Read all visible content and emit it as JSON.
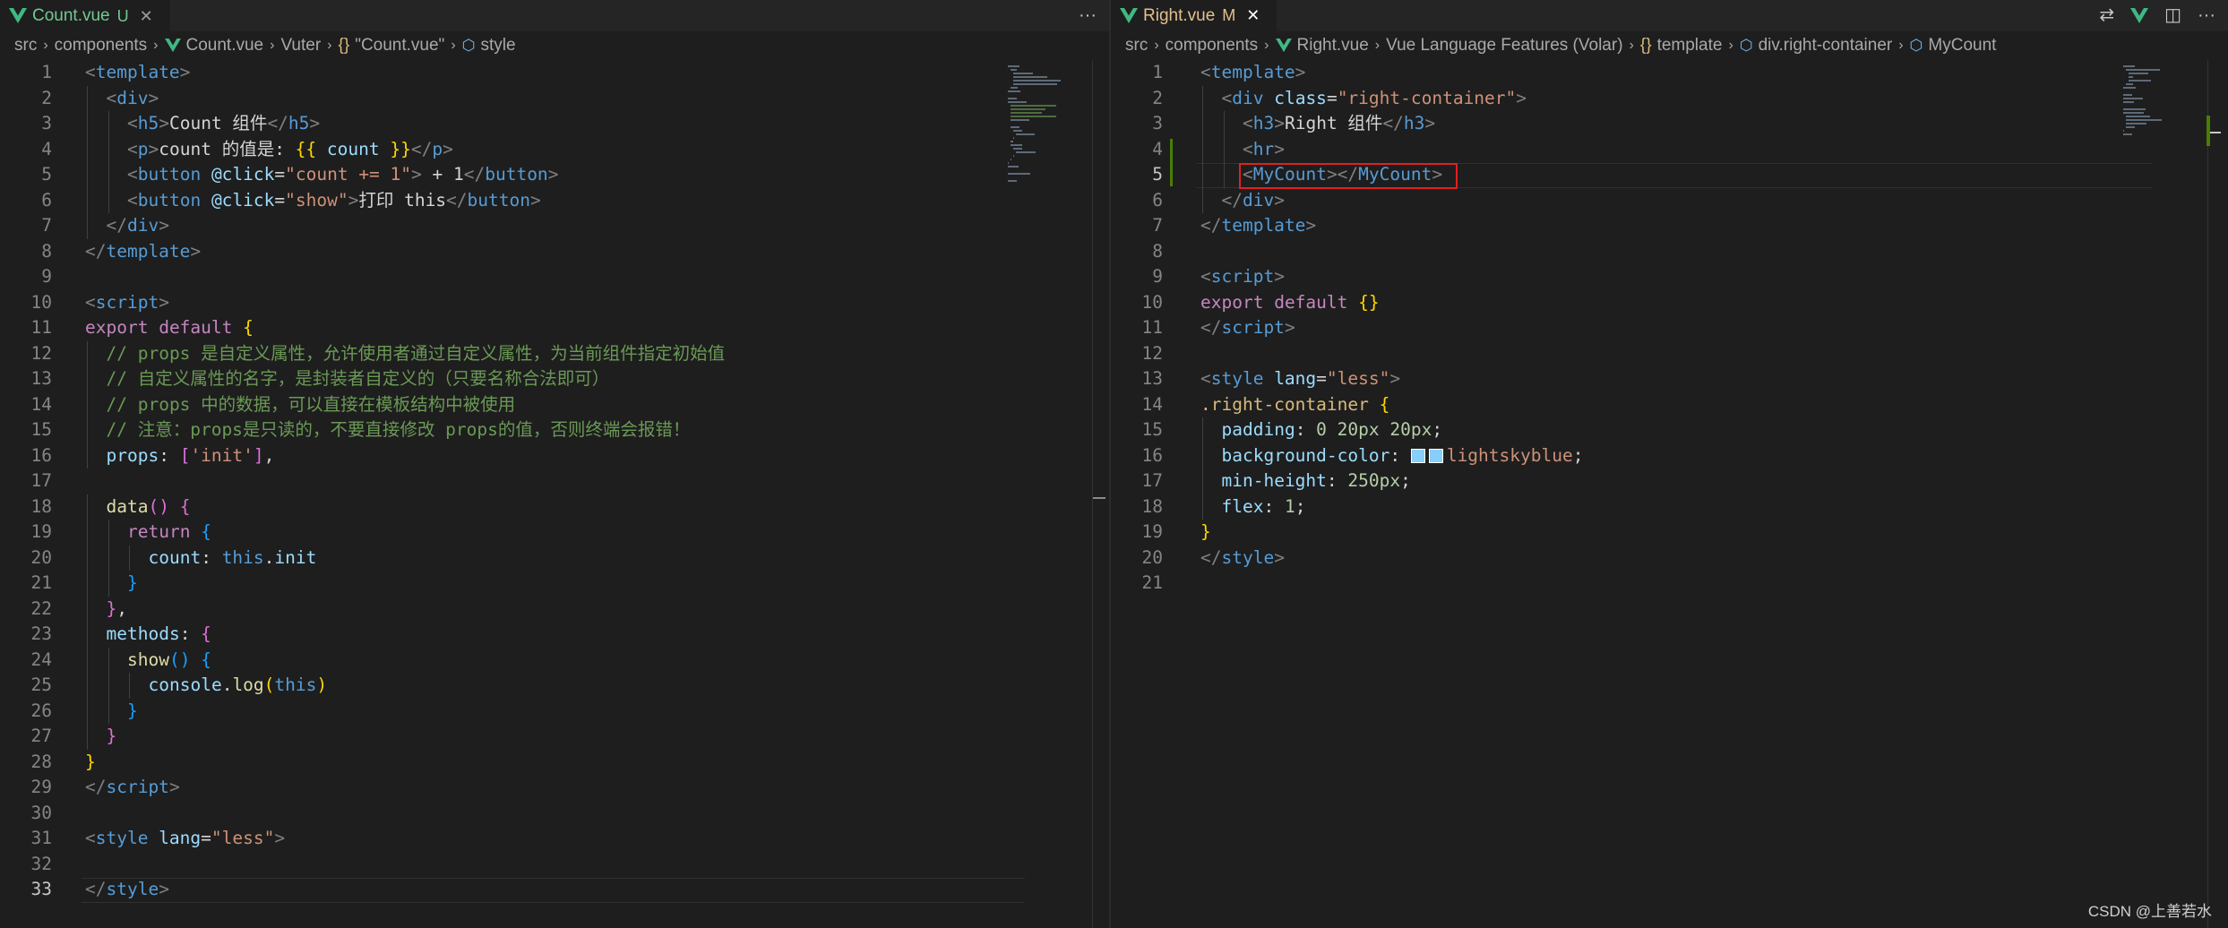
{
  "left_editor": {
    "tab": {
      "file_name": "Count.vue",
      "status": "U",
      "close_glyph": "✕",
      "state": "untracked"
    },
    "more_actions_glyph": "···",
    "breadcrumb": [
      {
        "label": "src",
        "icon": ""
      },
      {
        "label": "components",
        "icon": ""
      },
      {
        "label": "Count.vue",
        "icon": "vue-icon"
      },
      {
        "label": "Vuter",
        "icon": ""
      },
      {
        "label": "\"Count.vue\"",
        "icon": "curly-braces-icon"
      },
      {
        "label": "style",
        "icon": "style-symbol-icon"
      }
    ],
    "current_line": 33,
    "lines": [
      {
        "n": 1,
        "indent": 0,
        "tokens": [
          [
            "br",
            "<"
          ],
          [
            "tag",
            "template"
          ],
          [
            "br",
            ">"
          ]
        ]
      },
      {
        "n": 2,
        "indent": 1,
        "tokens": [
          [
            "br",
            "<"
          ],
          [
            "tag",
            "div"
          ],
          [
            "br",
            ">"
          ]
        ]
      },
      {
        "n": 3,
        "indent": 2,
        "tokens": [
          [
            "br",
            "<"
          ],
          [
            "tag",
            "h5"
          ],
          [
            "br",
            ">"
          ],
          [
            "txt",
            "Count 组件"
          ],
          [
            "br",
            "</"
          ],
          [
            "tag",
            "h5"
          ],
          [
            "br",
            ">"
          ]
        ]
      },
      {
        "n": 4,
        "indent": 2,
        "tokens": [
          [
            "br",
            "<"
          ],
          [
            "tag",
            "p"
          ],
          [
            "br",
            ">"
          ],
          [
            "txt",
            "count 的值是: "
          ],
          [
            "b1",
            "{{"
          ],
          [
            "attr",
            " count "
          ],
          [
            "b1",
            "}}"
          ],
          [
            "br",
            "</"
          ],
          [
            "tag",
            "p"
          ],
          [
            "br",
            ">"
          ]
        ]
      },
      {
        "n": 5,
        "indent": 2,
        "tokens": [
          [
            "br",
            "<"
          ],
          [
            "tag",
            "button"
          ],
          [
            "attr",
            " @click"
          ],
          [
            "txt",
            "="
          ],
          [
            "str",
            "\"count += 1\""
          ],
          [
            "br",
            ">"
          ],
          [
            "txt",
            " + 1"
          ],
          [
            "br",
            "</"
          ],
          [
            "tag",
            "button"
          ],
          [
            "br",
            ">"
          ]
        ]
      },
      {
        "n": 6,
        "indent": 2,
        "tokens": [
          [
            "br",
            "<"
          ],
          [
            "tag",
            "button"
          ],
          [
            "attr",
            " @click"
          ],
          [
            "txt",
            "="
          ],
          [
            "str",
            "\"show\""
          ],
          [
            "br",
            ">"
          ],
          [
            "txt",
            "打印 this"
          ],
          [
            "br",
            "</"
          ],
          [
            "tag",
            "button"
          ],
          [
            "br",
            ">"
          ]
        ]
      },
      {
        "n": 7,
        "indent": 1,
        "tokens": [
          [
            "br",
            "</"
          ],
          [
            "tag",
            "div"
          ],
          [
            "br",
            ">"
          ]
        ]
      },
      {
        "n": 8,
        "indent": 0,
        "tokens": [
          [
            "br",
            "</"
          ],
          [
            "tag",
            "template"
          ],
          [
            "br",
            ">"
          ]
        ]
      },
      {
        "n": 9,
        "indent": 0,
        "tokens": []
      },
      {
        "n": 10,
        "indent": 0,
        "tokens": [
          [
            "br",
            "<"
          ],
          [
            "tag",
            "script"
          ],
          [
            "br",
            ">"
          ]
        ]
      },
      {
        "n": 11,
        "indent": 0,
        "tokens": [
          [
            "kw",
            "export"
          ],
          [
            "plain",
            " "
          ],
          [
            "kw",
            "default"
          ],
          [
            "plain",
            " "
          ],
          [
            "b1",
            "{"
          ]
        ]
      },
      {
        "n": 12,
        "indent": 1,
        "tokens": [
          [
            "cmt",
            "// props 是自定义属性，允许使用者通过自定义属性，为当前组件指定初始值"
          ]
        ]
      },
      {
        "n": 13,
        "indent": 1,
        "tokens": [
          [
            "cmt",
            "// 自定义属性的名字，是封装者自定义的（只要名称合法即可）"
          ]
        ]
      },
      {
        "n": 14,
        "indent": 1,
        "tokens": [
          [
            "cmt",
            "// props 中的数据，可以直接在模板结构中被使用"
          ]
        ]
      },
      {
        "n": 15,
        "indent": 1,
        "tokens": [
          [
            "cmt",
            "// 注意：props是只读的，不要直接修改 props的值，否则终端会报错！"
          ]
        ]
      },
      {
        "n": 16,
        "indent": 1,
        "tokens": [
          [
            "prop",
            "props"
          ],
          [
            "plain",
            ": "
          ],
          [
            "b2",
            "["
          ],
          [
            "str",
            "'init'"
          ],
          [
            "b2",
            "]"
          ],
          [
            "plain",
            ","
          ]
        ]
      },
      {
        "n": 17,
        "indent": 0,
        "tokens": []
      },
      {
        "n": 18,
        "indent": 1,
        "tokens": [
          [
            "fn",
            "data"
          ],
          [
            "b2",
            "()"
          ],
          [
            "plain",
            " "
          ],
          [
            "b2",
            "{"
          ]
        ]
      },
      {
        "n": 19,
        "indent": 2,
        "tokens": [
          [
            "kw",
            "return"
          ],
          [
            "plain",
            " "
          ],
          [
            "b3",
            "{"
          ]
        ]
      },
      {
        "n": 20,
        "indent": 3,
        "tokens": [
          [
            "prop",
            "count"
          ],
          [
            "plain",
            ": "
          ],
          [
            "kw2",
            "this"
          ],
          [
            "plain",
            "."
          ],
          [
            "prop",
            "init"
          ]
        ]
      },
      {
        "n": 21,
        "indent": 2,
        "tokens": [
          [
            "b3",
            "}"
          ]
        ]
      },
      {
        "n": 22,
        "indent": 1,
        "tokens": [
          [
            "b2",
            "}"
          ],
          [
            "plain",
            ","
          ]
        ]
      },
      {
        "n": 23,
        "indent": 1,
        "tokens": [
          [
            "prop",
            "methods"
          ],
          [
            "plain",
            ": "
          ],
          [
            "b2",
            "{"
          ]
        ]
      },
      {
        "n": 24,
        "indent": 2,
        "tokens": [
          [
            "fn",
            "show"
          ],
          [
            "b3",
            "()"
          ],
          [
            "plain",
            " "
          ],
          [
            "b3",
            "{"
          ]
        ]
      },
      {
        "n": 25,
        "indent": 3,
        "tokens": [
          [
            "prop",
            "console"
          ],
          [
            "plain",
            "."
          ],
          [
            "fn",
            "log"
          ],
          [
            "b1",
            "("
          ],
          [
            "kw2",
            "this"
          ],
          [
            "b1",
            ")"
          ]
        ]
      },
      {
        "n": 26,
        "indent": 2,
        "tokens": [
          [
            "b3",
            "}"
          ]
        ]
      },
      {
        "n": 27,
        "indent": 1,
        "tokens": [
          [
            "b2",
            "}"
          ]
        ]
      },
      {
        "n": 28,
        "indent": 0,
        "tokens": [
          [
            "b1",
            "}"
          ]
        ]
      },
      {
        "n": 29,
        "indent": 0,
        "tokens": [
          [
            "br",
            "</"
          ],
          [
            "tag",
            "script"
          ],
          [
            "br",
            ">"
          ]
        ]
      },
      {
        "n": 30,
        "indent": 0,
        "tokens": []
      },
      {
        "n": 31,
        "indent": 0,
        "tokens": [
          [
            "br",
            "<"
          ],
          [
            "tag",
            "style"
          ],
          [
            "attr",
            " lang"
          ],
          [
            "txt",
            "="
          ],
          [
            "str",
            "\"less\""
          ],
          [
            "br",
            ">"
          ]
        ]
      },
      {
        "n": 32,
        "indent": 0,
        "tokens": []
      },
      {
        "n": 33,
        "indent": 0,
        "tokens": [
          [
            "br",
            "</"
          ],
          [
            "tag",
            "style"
          ],
          [
            "br",
            ">"
          ]
        ]
      }
    ]
  },
  "right_editor": {
    "tab": {
      "file_name": "Right.vue",
      "status": "M",
      "close_glyph": "✕",
      "state": "modified"
    },
    "actions": [
      {
        "name": "open-changes-icon",
        "glyph": "⇄"
      },
      {
        "name": "vue-devtools-icon",
        "glyph": ""
      },
      {
        "name": "split-editor-icon",
        "glyph": "◫"
      },
      {
        "name": "more-actions-icon",
        "glyph": "···"
      }
    ],
    "breadcrumb": [
      {
        "label": "src",
        "icon": ""
      },
      {
        "label": "components",
        "icon": ""
      },
      {
        "label": "Right.vue",
        "icon": "vue-icon"
      },
      {
        "label": "Vue Language Features (Volar)",
        "icon": ""
      },
      {
        "label": "template",
        "icon": "curly-braces-icon"
      },
      {
        "label": "div.right-container",
        "icon": "element-symbol-icon"
      },
      {
        "label": "MyCount",
        "icon": "element-symbol-icon"
      }
    ],
    "current_line": 5,
    "modified_line": 5,
    "lines": [
      {
        "n": 1,
        "indent": 0,
        "tokens": [
          [
            "br",
            "<"
          ],
          [
            "tag",
            "template"
          ],
          [
            "br",
            ">"
          ]
        ]
      },
      {
        "n": 2,
        "indent": 1,
        "tokens": [
          [
            "br",
            "<"
          ],
          [
            "tag",
            "div"
          ],
          [
            "attr",
            " class"
          ],
          [
            "txt",
            "="
          ],
          [
            "str",
            "\"right-container\""
          ],
          [
            "br",
            ">"
          ]
        ]
      },
      {
        "n": 3,
        "indent": 2,
        "tokens": [
          [
            "br",
            "<"
          ],
          [
            "tag",
            "h3"
          ],
          [
            "br",
            ">"
          ],
          [
            "txt",
            "Right 组件"
          ],
          [
            "br",
            "</"
          ],
          [
            "tag",
            "h3"
          ],
          [
            "br",
            ">"
          ]
        ]
      },
      {
        "n": 4,
        "indent": 2,
        "tokens": [
          [
            "br",
            "<"
          ],
          [
            "tag",
            "hr"
          ],
          [
            "br",
            ">"
          ]
        ]
      },
      {
        "n": 5,
        "indent": 2,
        "tokens": [
          [
            "br",
            "<"
          ],
          [
            "tag",
            "MyCount"
          ],
          [
            "br",
            "></"
          ],
          [
            "tag",
            "MyCount"
          ],
          [
            "br",
            ">"
          ]
        ]
      },
      {
        "n": 6,
        "indent": 1,
        "tokens": [
          [
            "br",
            "</"
          ],
          [
            "tag",
            "div"
          ],
          [
            "br",
            ">"
          ]
        ]
      },
      {
        "n": 7,
        "indent": 0,
        "tokens": [
          [
            "br",
            "</"
          ],
          [
            "tag",
            "template"
          ],
          [
            "br",
            ">"
          ]
        ]
      },
      {
        "n": 8,
        "indent": 0,
        "tokens": []
      },
      {
        "n": 9,
        "indent": 0,
        "tokens": [
          [
            "br",
            "<"
          ],
          [
            "tag",
            "script"
          ],
          [
            "br",
            ">"
          ]
        ]
      },
      {
        "n": 10,
        "indent": 0,
        "tokens": [
          [
            "kw",
            "export"
          ],
          [
            "plain",
            " "
          ],
          [
            "kw",
            "default"
          ],
          [
            "plain",
            " "
          ],
          [
            "b1",
            "{}"
          ]
        ]
      },
      {
        "n": 11,
        "indent": 0,
        "tokens": [
          [
            "br",
            "</"
          ],
          [
            "tag",
            "script"
          ],
          [
            "br",
            ">"
          ]
        ]
      },
      {
        "n": 12,
        "indent": 0,
        "tokens": []
      },
      {
        "n": 13,
        "indent": 0,
        "tokens": [
          [
            "br",
            "<"
          ],
          [
            "tag",
            "style"
          ],
          [
            "attr",
            " lang"
          ],
          [
            "txt",
            "="
          ],
          [
            "str",
            "\"less\""
          ],
          [
            "br",
            ">"
          ]
        ]
      },
      {
        "n": 14,
        "indent": 0,
        "tokens": [
          [
            "sel",
            ".right-container"
          ],
          [
            "plain",
            " "
          ],
          [
            "b1",
            "{"
          ]
        ]
      },
      {
        "n": 15,
        "indent": 1,
        "tokens": [
          [
            "prop",
            "padding"
          ],
          [
            "plain",
            ": "
          ],
          [
            "num",
            "0"
          ],
          [
            "plain",
            " "
          ],
          [
            "num",
            "20px"
          ],
          [
            "plain",
            " "
          ],
          [
            "num",
            "20px"
          ],
          [
            "plain",
            ";"
          ]
        ]
      },
      {
        "n": 16,
        "indent": 1,
        "tokens": [
          [
            "prop",
            "background-color"
          ],
          [
            "plain",
            ": "
          ],
          [
            "swatch",
            ""
          ],
          [
            "swatch",
            ""
          ],
          [
            "str",
            "lightskyblue"
          ],
          [
            "plain",
            ";"
          ]
        ]
      },
      {
        "n": 17,
        "indent": 1,
        "tokens": [
          [
            "prop",
            "min-height"
          ],
          [
            "plain",
            ": "
          ],
          [
            "num",
            "250px"
          ],
          [
            "plain",
            ";"
          ]
        ]
      },
      {
        "n": 18,
        "indent": 1,
        "tokens": [
          [
            "prop",
            "flex"
          ],
          [
            "plain",
            ": "
          ],
          [
            "num",
            "1"
          ],
          [
            "plain",
            ";"
          ]
        ]
      },
      {
        "n": 19,
        "indent": 0,
        "tokens": [
          [
            "b1",
            "}"
          ]
        ]
      },
      {
        "n": 20,
        "indent": 0,
        "tokens": [
          [
            "br",
            "</"
          ],
          [
            "tag",
            "style"
          ],
          [
            "br",
            ">"
          ]
        ]
      },
      {
        "n": 21,
        "indent": 0,
        "tokens": []
      }
    ]
  },
  "highlight": {
    "color": "#e02020",
    "line": 5
  },
  "colors": {
    "editor_bg": "#1e1e1e",
    "tabbar_bg": "#252526",
    "untracked": "#73c991",
    "modified": "#e2c08d",
    "vue_green": "#41b883",
    "swatch": "#87cefa"
  },
  "watermark": "CSDN @上善若水"
}
